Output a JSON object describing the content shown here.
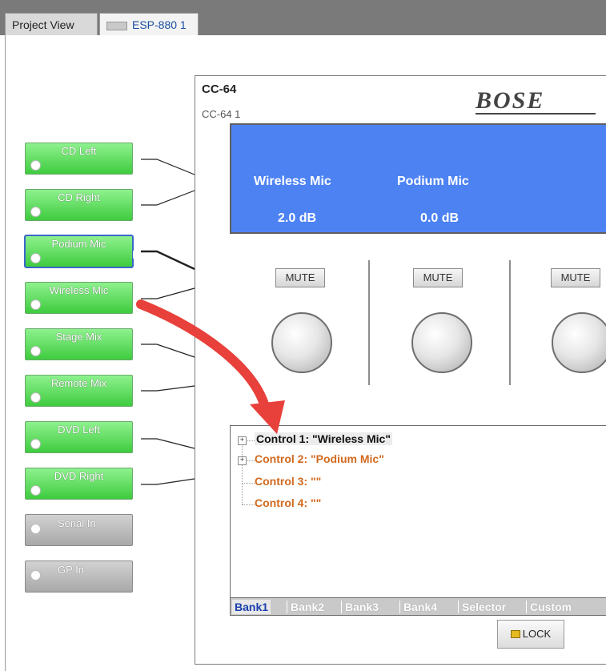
{
  "tabs": {
    "project_view": "Project View",
    "device": "ESP-880 1"
  },
  "inputs": [
    {
      "label": "CD Left",
      "color": "#4fd34f"
    },
    {
      "label": "CD Right",
      "color": "#4fd34f"
    },
    {
      "label": "Podium Mic",
      "color": "#4fd34f",
      "selected": true
    },
    {
      "label": "Wireless Mic",
      "color": "#4fd34f"
    },
    {
      "label": "Stage Mix",
      "color": "#4fd34f"
    },
    {
      "label": "Remote Mix",
      "color": "#4fd34f"
    },
    {
      "label": "DVD Left",
      "color": "#4fd34f"
    },
    {
      "label": "DVD Right",
      "color": "#4fd34f"
    },
    {
      "label": "Serial In",
      "color": "#bcbcbc"
    },
    {
      "label": "GP In",
      "color": "#bcbcbc"
    }
  ],
  "panel": {
    "title": "CC-64",
    "subtitle": "CC-64 1",
    "brand": "BOSE",
    "display_color": "#4d82f3",
    "channels": [
      {
        "name": "Wireless Mic",
        "value": "2.0 dB"
      },
      {
        "name": "Podium Mic",
        "value": "0.0 dB"
      }
    ],
    "mute_label": "MUTE",
    "tree": [
      {
        "label": "Control 1: \"Wireless Mic\"",
        "expandable": true,
        "selected": true
      },
      {
        "label": "Control 2: \"Podium Mic\"",
        "expandable": true
      },
      {
        "label": "Control 3: \"\"",
        "expandable": false
      },
      {
        "label": "Control 4: \"\"",
        "expandable": false
      }
    ],
    "bank_tabs": [
      "Bank1",
      "Bank2",
      "Bank3",
      "Bank4",
      "Selector",
      "Custom"
    ],
    "active_bank": "Bank1",
    "lock_label": "LOCK"
  },
  "annotation_arrow_color": "#e8403a",
  "tree_text_color": "#d2691e"
}
